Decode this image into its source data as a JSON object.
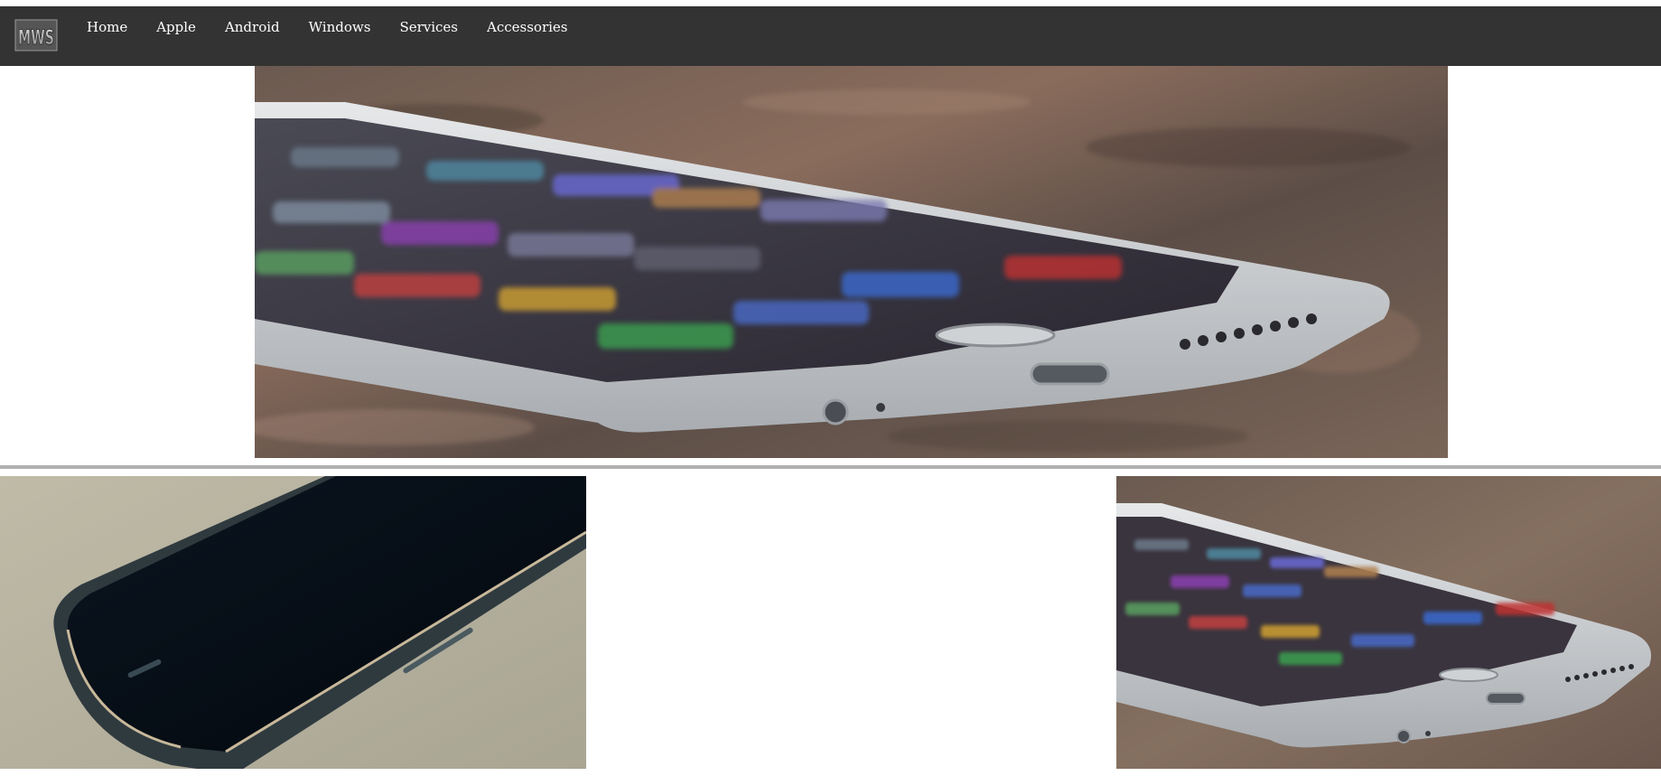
{
  "navbar": {
    "logo_text": "MWS",
    "links": [
      {
        "label": "Home"
      },
      {
        "label": "Apple"
      },
      {
        "label": "Android"
      },
      {
        "label": "Windows"
      },
      {
        "label": "Services"
      },
      {
        "label": "Accessories"
      }
    ],
    "background": "#333333",
    "link_color": "#ffffff"
  },
  "images": {
    "hero": {
      "subject": "white iphone lying on granite surface",
      "icon": "phone-photo"
    },
    "left_thumb": {
      "subject": "black android phone on beige surface",
      "icon": "phone-photo"
    },
    "right_thumb": {
      "subject": "white iphone lying on granite surface",
      "icon": "phone-photo"
    }
  },
  "colors": {
    "divider": "#b0b0b0",
    "page_background": "#ffffff"
  }
}
